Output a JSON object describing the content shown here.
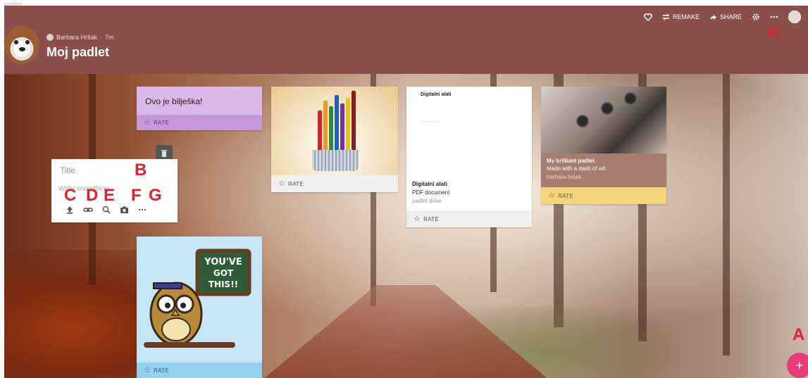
{
  "app": {
    "name": "padlet"
  },
  "header": {
    "author": "Barbara Hršak",
    "time": "7m",
    "title": "Moj padlet",
    "actions": {
      "remake": "REMAKE",
      "share": "SHARE"
    },
    "bg_color": "#8a4f4a"
  },
  "cards": {
    "note": {
      "text": "Ovo je bilješka!",
      "rate": "RATE"
    },
    "pencils": {
      "rate": "RATE"
    },
    "doc": {
      "preview_title": "Digitalni alati",
      "name": "Digitalni alati",
      "type": "PDF document",
      "source": "padlet drive",
      "rate": "RATE"
    },
    "brilliant": {
      "title": "My brilliant padlet",
      "subtitle": "Made with a dash of wit",
      "author": "barbara hršak",
      "rate": "RATE"
    },
    "owl": {
      "sign_line1": "YOU'VE",
      "sign_line2": "GOT",
      "sign_line3": "THIS!!",
      "rate": "RATE"
    }
  },
  "composer": {
    "title_placeholder": "Title",
    "body_placeholder": "Write something..."
  },
  "annotations": {
    "A": "A",
    "B": "B",
    "C": "C",
    "D": "D",
    "E": "E",
    "F": "F",
    "G": "G",
    "H": "H"
  },
  "fab": {
    "label": "+"
  },
  "colors": {
    "accent_fab": "#e83c7a",
    "annotation": "#e0202a"
  }
}
